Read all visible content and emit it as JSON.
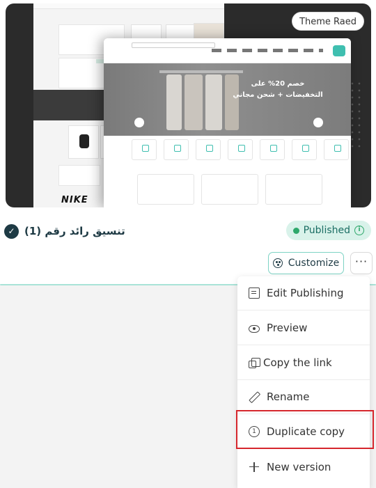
{
  "preview": {
    "badge": "Theme Raed",
    "hero_text": "خصم 20% على التخفيضات + شحن مجاني",
    "brand_logo": "NIKE"
  },
  "theme": {
    "name": "تنسيق رائد رقم (1)",
    "status": "Published",
    "status_color": "#2ea86b"
  },
  "actions": {
    "customize_label": "Customize",
    "more_label": "···"
  },
  "menu": {
    "items": [
      {
        "label": "Edit Publishing",
        "icon": "edit-document-icon"
      },
      {
        "label": "Preview",
        "icon": "eye-icon"
      },
      {
        "label": "Copy the link",
        "icon": "copy-icon"
      },
      {
        "label": "Rename",
        "icon": "pencil-icon"
      },
      {
        "label": "Duplicate copy",
        "icon": "duplicate-icon"
      },
      {
        "label": "New version",
        "icon": "plus-icon"
      }
    ],
    "highlighted_item": "Duplicate copy",
    "highlight_color": "#d6262c"
  },
  "colors": {
    "accent": "#7dd3c4",
    "dark_text": "#1e3a44",
    "published_bg": "#d9f2ea"
  }
}
